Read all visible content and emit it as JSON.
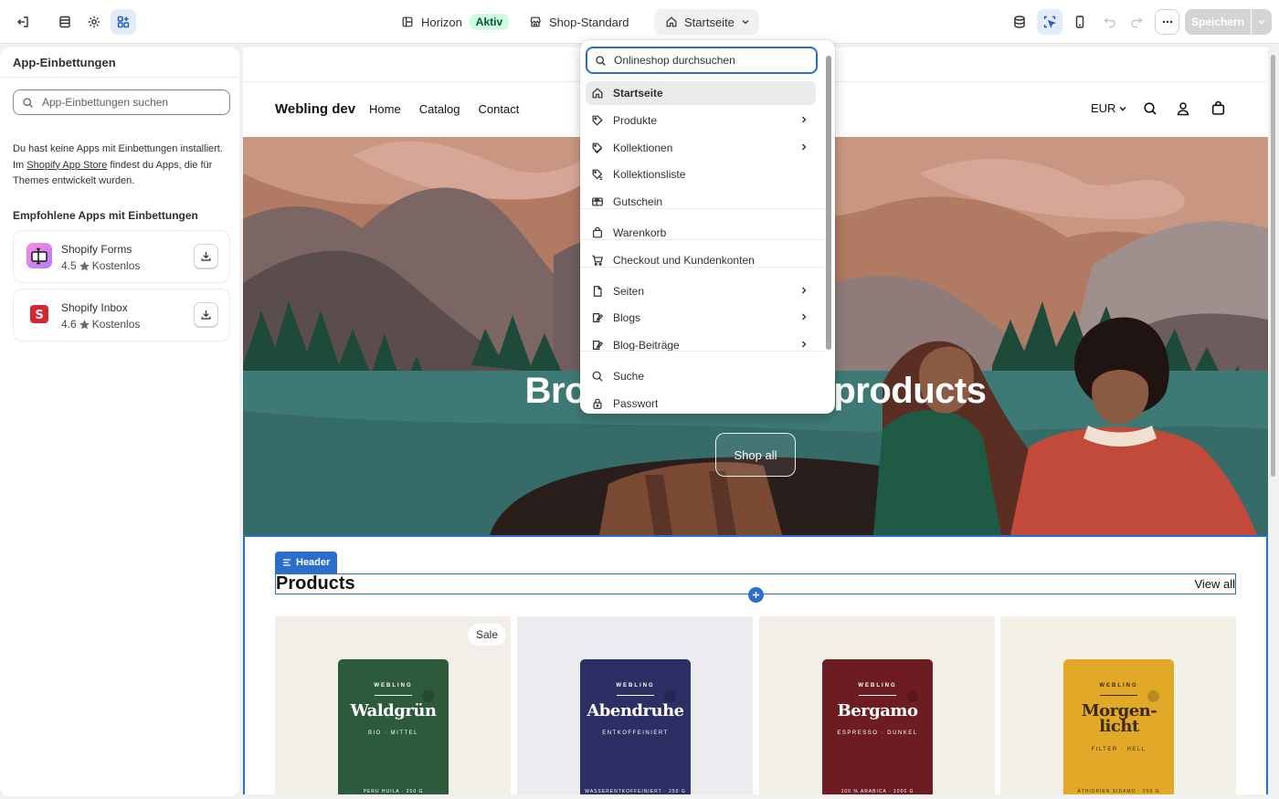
{
  "topbar": {
    "theme_name": "Horizon",
    "theme_status": "Aktiv",
    "shop_template": "Shop-Standard",
    "current_page": "Startseite",
    "save_label": "Speichern"
  },
  "sidebar": {
    "title": "App-Einbettungen",
    "search_placeholder": "App-Einbettungen suchen",
    "info_line1": "Du hast keine Apps mit Einbettungen installiert.",
    "info_prefix": "Im ",
    "info_link": "Shopify App Store",
    "info_suffix": " findest du Apps, die für",
    "info_line3": "Themes entwickelt wurden.",
    "recommended_title": "Empfohlene Apps mit Einbettungen",
    "apps": [
      {
        "name": "Shopify Forms",
        "rating": "4.5",
        "price": "Kostenlos"
      },
      {
        "name": "Shopify Inbox",
        "rating": "4.6",
        "price": "Kostenlos"
      }
    ]
  },
  "dropdown": {
    "search_placeholder": "Onlineshop durchsuchen",
    "items": [
      {
        "label": "Startseite",
        "icon": "home-icon",
        "has_children": false
      },
      {
        "label": "Produkte",
        "icon": "tag-icon",
        "has_children": true
      },
      {
        "label": "Kollektionen",
        "icon": "tags-icon",
        "has_children": true
      },
      {
        "label": "Kollektionsliste",
        "icon": "tags-list-icon",
        "has_children": false
      },
      {
        "label": "Gutschein",
        "icon": "gift-card-icon",
        "has_children": false
      },
      {
        "label": "Warenkorb",
        "icon": "bag-icon",
        "has_children": false
      },
      {
        "label": "Checkout und Kundenkonten",
        "icon": "cart-icon",
        "has_children": false
      },
      {
        "label": "Seiten",
        "icon": "page-icon",
        "has_children": true
      },
      {
        "label": "Blogs",
        "icon": "blog-icon",
        "has_children": true
      },
      {
        "label": "Blog-Beiträge",
        "icon": "blog-post-icon",
        "has_children": true
      },
      {
        "label": "Suche",
        "icon": "search-icon",
        "has_children": false
      },
      {
        "label": "Passwort",
        "icon": "lock-icon",
        "has_children": false
      }
    ]
  },
  "store": {
    "brand": "Webling dev",
    "nav": [
      "Home",
      "Catalog",
      "Contact"
    ],
    "currency": "EUR",
    "hero_title": "Browse our latest products",
    "hero_button": "Shop all",
    "section_tag": "Header",
    "products_title": "Products",
    "view_all": "View all",
    "sale_label": "Sale",
    "products": [
      {
        "brand": "WEBLING",
        "name": "Waldgrün",
        "sub": "BIO · MITTEL",
        "foot": "PERU HUILA · 250 G",
        "bg": "#f1efe7",
        "bag": "#2e5a3c",
        "ink": "#ffffff"
      },
      {
        "brand": "WEBLING",
        "name": "Abendruhe",
        "sub": "ENTKOFFEINIERT",
        "foot": "WASSERENTKOFFEINIERT · 250 G",
        "bg": "#ececf0",
        "bag": "#2c2f63",
        "ink": "#ffffff"
      },
      {
        "brand": "WEBLING",
        "name": "Bergamo",
        "sub": "ESPRESSO · DUNKEL",
        "foot": "100 % ARABICA · 1000 G",
        "bg": "#f1efe7",
        "bag": "#6d1d22",
        "ink": "#ffffff"
      },
      {
        "brand": "WEBLING",
        "name": "Morgen-licht",
        "sub": "FILTER · HELL",
        "foot": "ÄTHIOPIEN SIDAMO · 250 G",
        "bg": "#f3f0e6",
        "bag": "#e2a929",
        "ink": "#3a2a0a"
      }
    ]
  },
  "colors": {
    "accent": "#2c6ecb",
    "aktiv_bg": "#cdfee1",
    "aktiv_text": "#0c5132"
  }
}
